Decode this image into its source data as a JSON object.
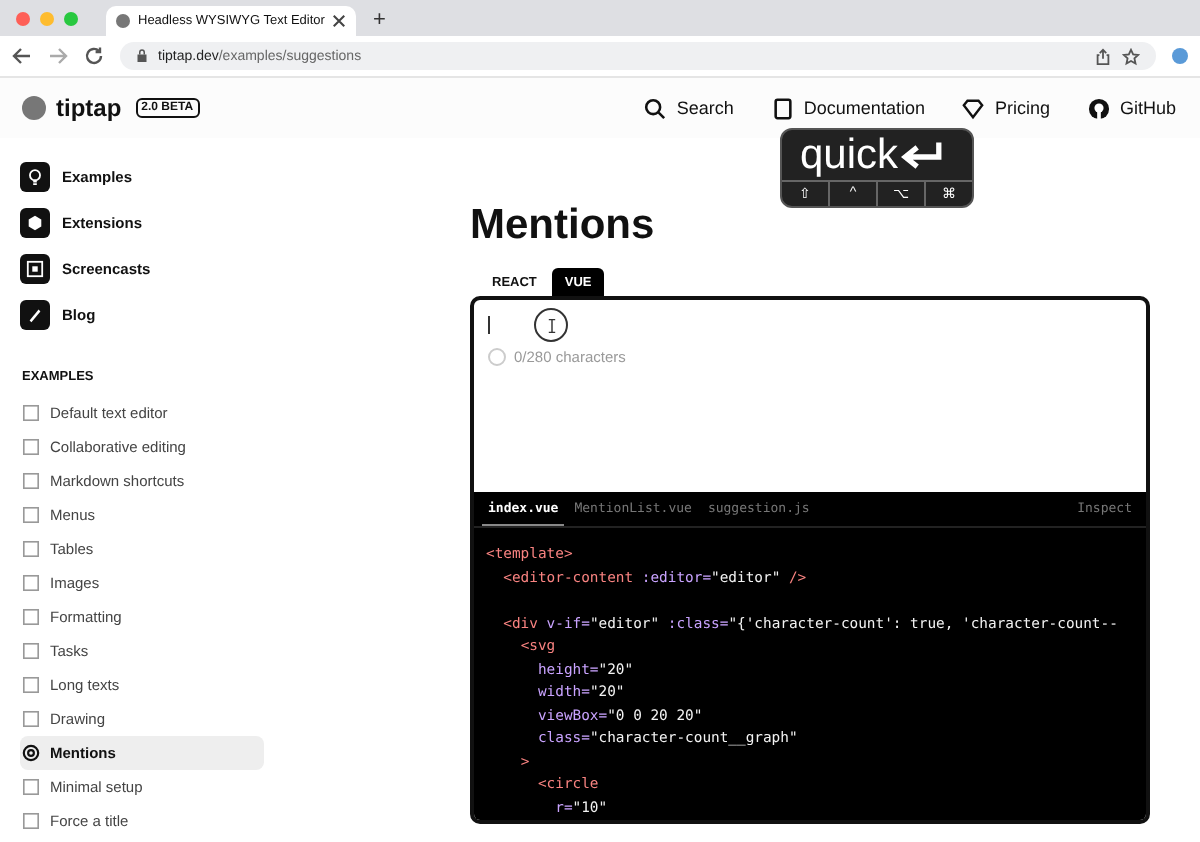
{
  "browser": {
    "tab_title": "Headless WYSIWYG Text Editor",
    "new_tab": "+",
    "url_host": "tiptap.dev",
    "url_path": "/examples/suggestions"
  },
  "header": {
    "logo": "tiptap",
    "badge": "2.0 BETA",
    "nav": [
      {
        "kind": "search",
        "label": "Search"
      },
      {
        "kind": "docs",
        "label": "Documentation"
      },
      {
        "kind": "pricing",
        "label": "Pricing"
      },
      {
        "kind": "github",
        "label": "GitHub"
      }
    ]
  },
  "keystroke_overlay": {
    "text": "quick",
    "keys": [
      "⇧",
      "^",
      "⌥",
      "⌘"
    ]
  },
  "sidebar": {
    "top": [
      {
        "kind": "bulb",
        "label": "Examples"
      },
      {
        "kind": "box",
        "label": "Extensions"
      },
      {
        "kind": "screen",
        "label": "Screencasts"
      },
      {
        "kind": "pen",
        "label": "Blog"
      }
    ],
    "section": "EXAMPLES",
    "items": [
      {
        "label": "Default text editor",
        "selected": false
      },
      {
        "label": "Collaborative editing",
        "selected": false
      },
      {
        "label": "Markdown shortcuts",
        "selected": false
      },
      {
        "label": "Menus",
        "selected": false
      },
      {
        "label": "Tables",
        "selected": false
      },
      {
        "label": "Images",
        "selected": false
      },
      {
        "label": "Formatting",
        "selected": false
      },
      {
        "label": "Tasks",
        "selected": false
      },
      {
        "label": "Long texts",
        "selected": false
      },
      {
        "label": "Drawing",
        "selected": false
      },
      {
        "label": "Mentions",
        "selected": true
      },
      {
        "label": "Minimal setup",
        "selected": false
      },
      {
        "label": "Force a title",
        "selected": false
      }
    ]
  },
  "main": {
    "title": "Mentions",
    "tabs": [
      {
        "label": "REACT",
        "selected": false
      },
      {
        "label": "VUE",
        "selected": true
      }
    ],
    "editor": {
      "counter": "0/280 characters"
    },
    "code": {
      "files": [
        {
          "label": "index.vue",
          "selected": true
        },
        {
          "label": "MentionList.vue",
          "selected": false
        },
        {
          "label": "suggestion.js",
          "selected": false
        }
      ],
      "inspect": "Inspect",
      "blocks": [
        [
          "<template>",
          "  <editor-content :editor=\"editor\" />"
        ],
        [
          "  <div v-if=\"editor\" :class=\"{'character-count': true, 'character-count--",
          "    <svg",
          "      height=\"20\"",
          "      width=\"20\"",
          "      viewBox=\"0 0 20 20\"",
          "      class=\"character-count__graph\"",
          "    >",
          "      <circle",
          "        r=\"10\""
        ]
      ]
    }
  }
}
